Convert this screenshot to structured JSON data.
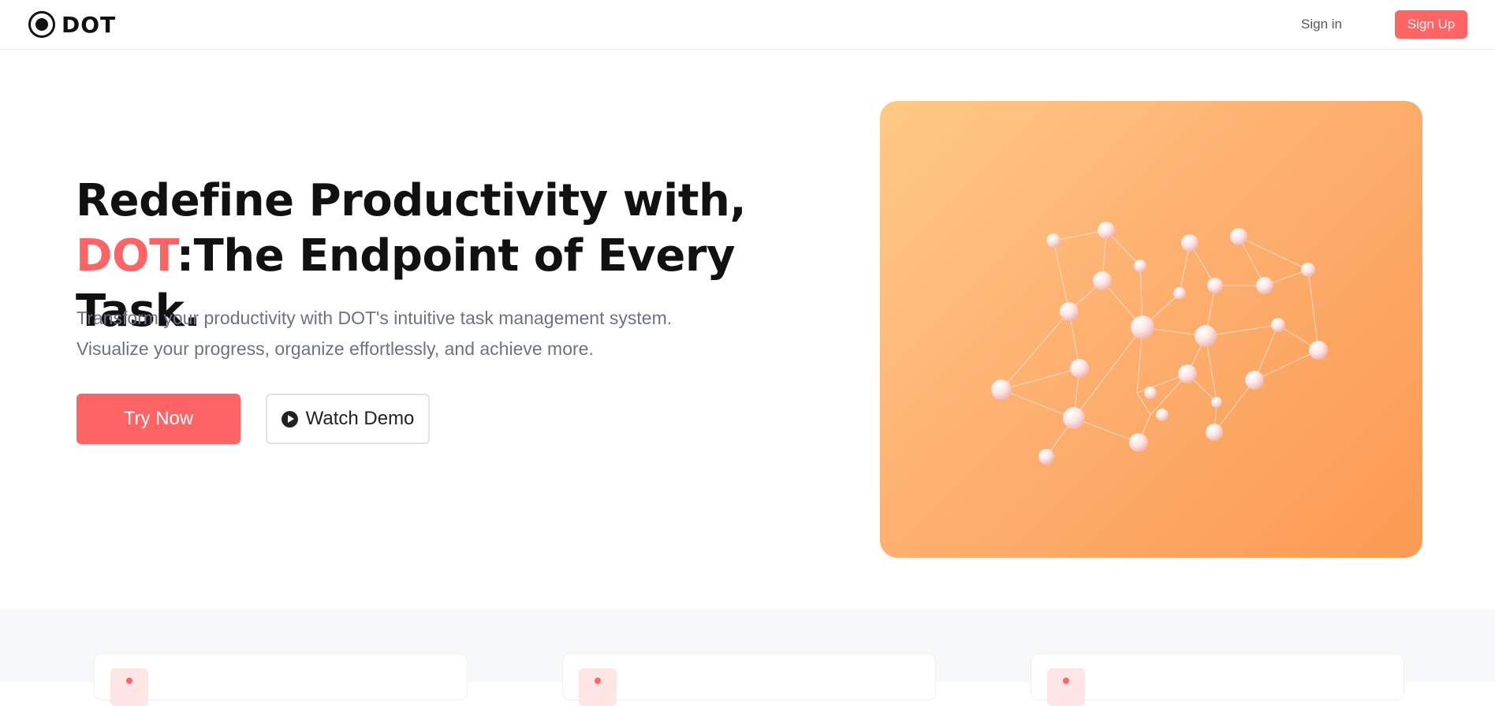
{
  "header": {
    "brand_name": "DOT",
    "signin_label": "Sign in",
    "signup_label": "Sign Up"
  },
  "hero": {
    "title_line1": "Redefine Productivity with,",
    "title_accent": "DOT",
    "title_line2": ":The Endpoint of Every Task.",
    "subtitle_line1": "Transform your productivity with DOT's intuitive task management system.",
    "subtitle_line2": "Visualize your progress, organize effortlessly, and achieve more.",
    "primary_cta": "Try Now",
    "secondary_cta": "Watch Demo"
  },
  "colors": {
    "accent": "#ff6464",
    "text_dark": "#111111",
    "text_muted": "#6b7280",
    "gradient_start": "#ffc985",
    "gradient_end": "#fb9a52",
    "feature_band": "#f7f8fa"
  },
  "icons": {
    "logo": "dot-logo-icon",
    "play": "play-circle-icon",
    "illustration": "network-nodes-illustration"
  }
}
